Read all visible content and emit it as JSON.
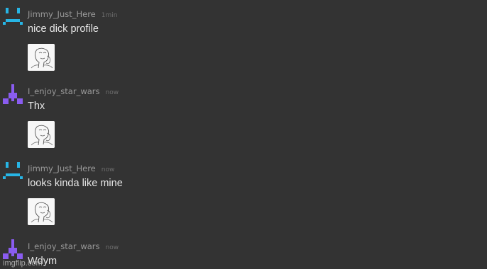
{
  "colors": {
    "background": "#333333",
    "avatar_jimmy": "#27b5e5",
    "avatar_star_wars": "#8a5cf0"
  },
  "messages": [
    {
      "user": "Jimmy_Just_Here",
      "time": "1min",
      "text": "nice dick profile",
      "avatar": "pixel-face-icon",
      "attachment": "meme-thumbnail"
    },
    {
      "user": "I_enjoy_star_wars",
      "time": "now",
      "text": "Thx",
      "avatar": "pixel-triangle-icon",
      "attachment": "meme-thumbnail"
    },
    {
      "user": "Jimmy_Just_Here",
      "time": "now",
      "text": "looks kinda like mine",
      "avatar": "pixel-face-icon",
      "attachment": "meme-thumbnail"
    },
    {
      "user": "I_enjoy_star_wars",
      "time": "now",
      "text": "Wdym",
      "avatar": "pixel-triangle-icon"
    }
  ],
  "watermark": "imgflip.com"
}
